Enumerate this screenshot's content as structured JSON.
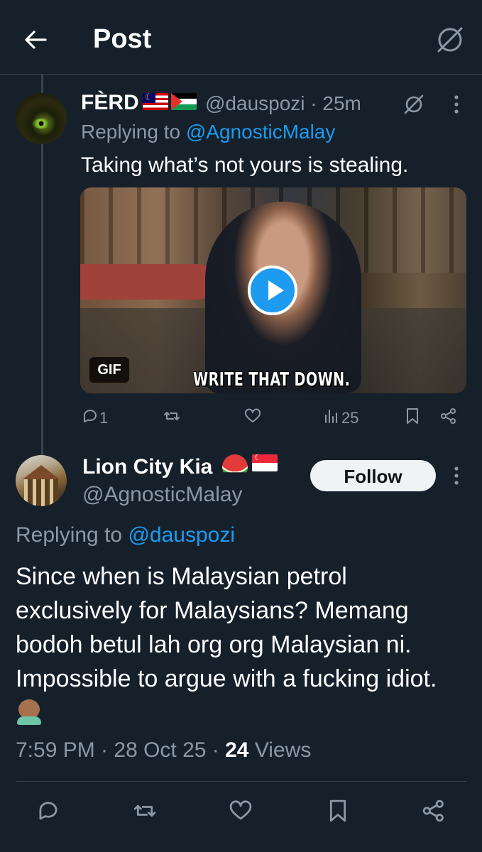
{
  "header": {
    "title": "Post"
  },
  "reply_tweet": {
    "name": "FÈRD",
    "handle_time": "@dauspozi · 25m",
    "replying_prefix": "Replying to ",
    "replying_to": "@AgnosticMalay",
    "text": "Taking what’s not yours is stealing.",
    "media": {
      "badge": "GIF",
      "caption": "WRITE THAT DOWN."
    },
    "stats": {
      "replies": "1",
      "views": "25"
    }
  },
  "main_tweet": {
    "name": "Lion City Kia",
    "handle": "@AgnosticMalay",
    "follow_label": "Follow",
    "replying_prefix": "Replying to ",
    "replying_to": "@dauspozi",
    "text": "Since when is Malaysian petrol exclusively for Malaysians? Memang bodoh betul lah org org Malaysian ni. Impossible to argue with a fucking idiot. ",
    "time": "7:59 PM · 28 Oct 25 · ",
    "views_count": "24",
    "views_label": " Views"
  },
  "colors": {
    "background": "#15202b",
    "accent": "#1d9bf0",
    "muted": "#8b98a5",
    "divider": "#38444d"
  }
}
